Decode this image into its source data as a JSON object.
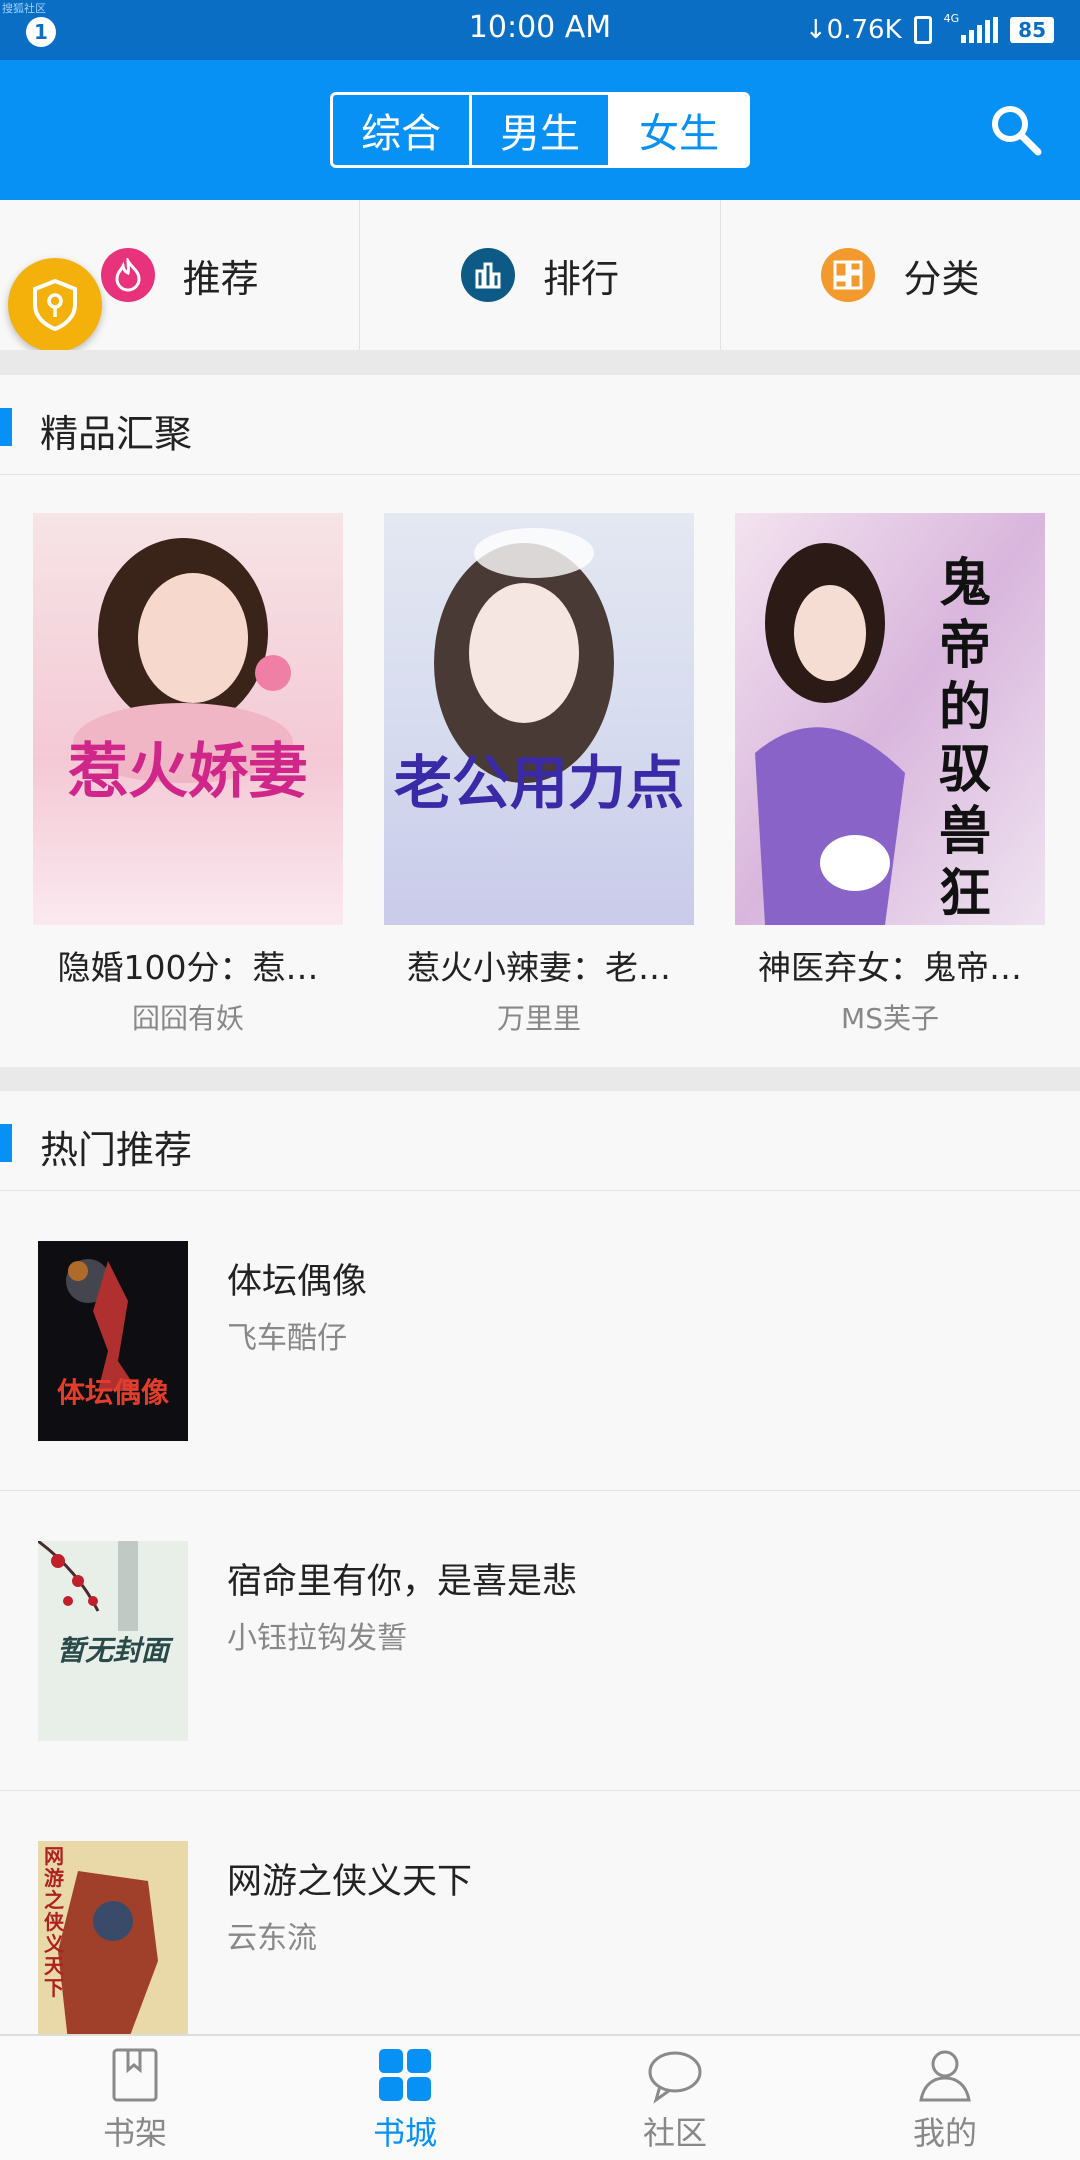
{
  "status_bar": {
    "tiny_label": "搜狐社区",
    "notification_count": "1",
    "time": "10:00 AM",
    "net_speed": "↓0.76K",
    "network_type": "4G",
    "battery": "85"
  },
  "header": {
    "segments": [
      "综合",
      "男生",
      "女生"
    ],
    "active_segment": "女生"
  },
  "nav": {
    "items": [
      {
        "label": "推荐",
        "icon": "flame-icon",
        "color": "#e8327c"
      },
      {
        "label": "排行",
        "icon": "bar-chart-icon",
        "color": "#0d5a86"
      },
      {
        "label": "分类",
        "icon": "grid-icon",
        "color": "#f39a2e"
      }
    ]
  },
  "featured": {
    "title": "精品汇聚",
    "books": [
      {
        "title": "隐婚100分：惹…",
        "author": "囧囧有妖",
        "cover_text": "惹火娇妻"
      },
      {
        "title": "惹火小辣妻：老…",
        "author": "万里里",
        "cover_text": "老公用力点"
      },
      {
        "title": "神医弃女：鬼帝…",
        "author": "MS芙子",
        "cover_text": "鬼帝的驭兽狂妃"
      }
    ]
  },
  "hot": {
    "title": "热门推荐",
    "books": [
      {
        "title": "体坛偶像",
        "author": "飞车酷仔",
        "cover_text": "体坛偶像"
      },
      {
        "title": "宿命里有你，是喜是悲",
        "author": "小钰拉钩发誓",
        "cover_text": "暂无封面"
      },
      {
        "title": "网游之侠义天下",
        "author": "云东流",
        "cover_text": "网游之侠义天下"
      }
    ]
  },
  "tabbar": {
    "tabs": [
      "书架",
      "书城",
      "社区",
      "我的"
    ],
    "active": "书城"
  },
  "colors": {
    "primary": "#0891f5",
    "status_bar": "#0a6fc4",
    "floating_button": "#f5b10b"
  }
}
